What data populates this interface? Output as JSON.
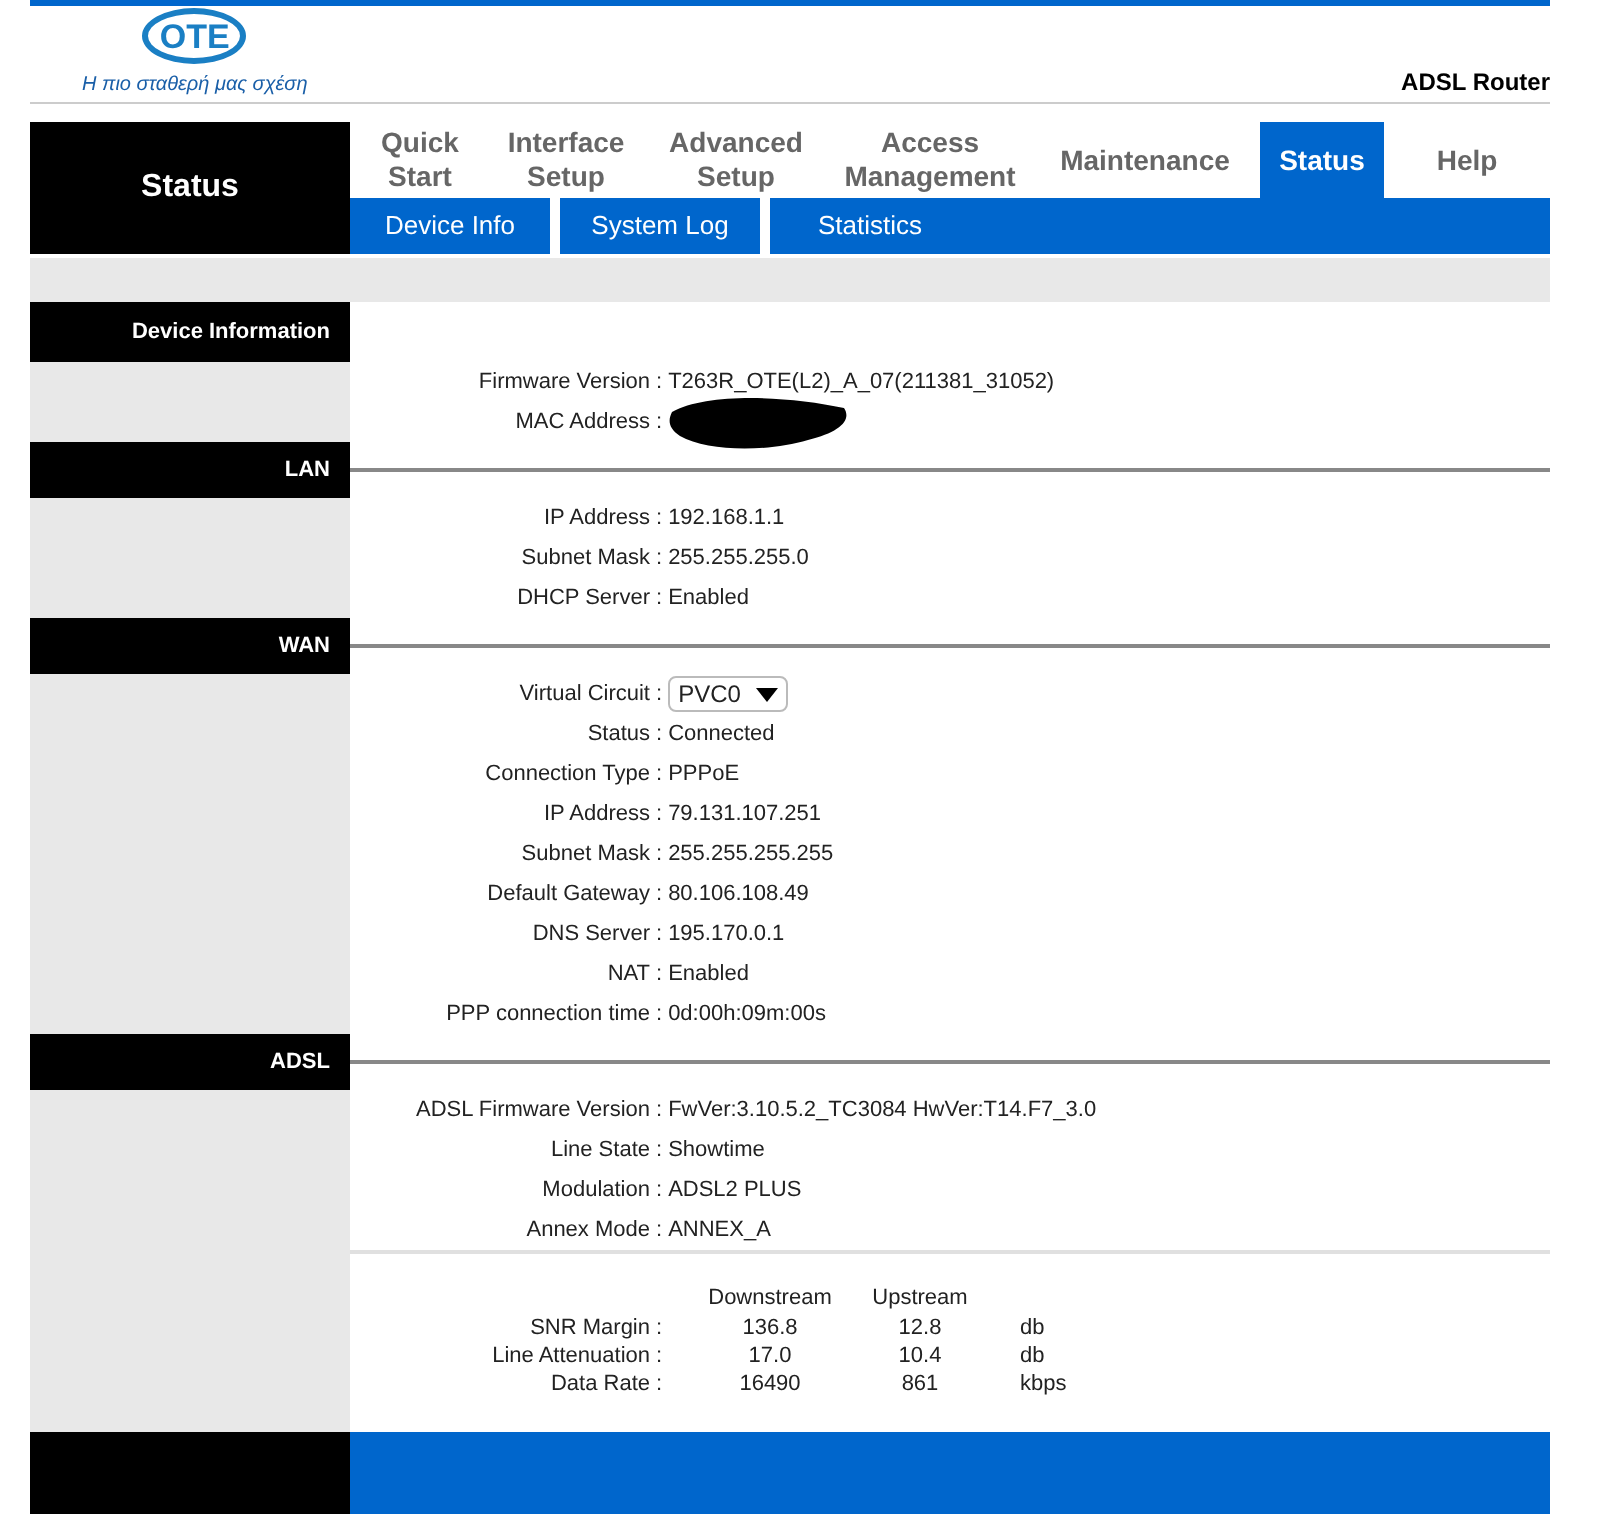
{
  "header": {
    "logo_text": "OTE",
    "tagline": "Η πιο σταθερή μας σχέση",
    "product": "ADSL Router"
  },
  "nav": {
    "section_title": "Status",
    "tabs": [
      {
        "label": "Quick Start",
        "selected": false
      },
      {
        "label": "Interface Setup",
        "selected": false
      },
      {
        "label": "Advanced Setup",
        "selected": false
      },
      {
        "label": "Access Management",
        "selected": false
      },
      {
        "label": "Maintenance",
        "selected": false
      },
      {
        "label": "Status",
        "selected": true
      },
      {
        "label": "Help",
        "selected": false
      }
    ],
    "subtabs": [
      {
        "label": "Device Info"
      },
      {
        "label": "System Log"
      },
      {
        "label": "Statistics"
      }
    ]
  },
  "sections": [
    {
      "title": "Device Information",
      "rows": [
        {
          "kind": "text",
          "label": "Firmware Version",
          "sep": ":",
          "value": "T263R_OTE(L2)_A_07(211381_31052)"
        },
        {
          "kind": "redacted",
          "label": "MAC Address",
          "sep": ":"
        }
      ]
    },
    {
      "title": "LAN",
      "rows": [
        {
          "kind": "text",
          "label": "IP Address",
          "sep": ":",
          "value": "192.168.1.1"
        },
        {
          "kind": "text",
          "label": "Subnet Mask",
          "sep": ":",
          "value": "255.255.255.0"
        },
        {
          "kind": "text",
          "label": "DHCP Server",
          "sep": ":",
          "value": "Enabled"
        }
      ]
    },
    {
      "title": "WAN",
      "rows": [
        {
          "kind": "select",
          "label": "Virtual Circuit",
          "sep": ":",
          "value": "PVC0"
        },
        {
          "kind": "text",
          "label": "Status",
          "sep": ":",
          "value": "Connected"
        },
        {
          "kind": "text",
          "label": "Connection Type",
          "sep": ":",
          "value": "PPPoE"
        },
        {
          "kind": "text",
          "label": "IP Address",
          "sep": ":",
          "value": "79.131.107.251"
        },
        {
          "kind": "text",
          "label": "Subnet Mask",
          "sep": ":",
          "value": "255.255.255.255"
        },
        {
          "kind": "text",
          "label": "Default Gateway",
          "sep": ":",
          "value": "80.106.108.49"
        },
        {
          "kind": "text",
          "label": "DNS Server",
          "sep": ":",
          "value": "195.170.0.1"
        },
        {
          "kind": "text",
          "label": "NAT",
          "sep": ":",
          "value": "Enabled"
        },
        {
          "kind": "text",
          "label": "PPP connection time",
          "sep": ":",
          "value": "0d:00h:09m:00s"
        }
      ]
    },
    {
      "title": "ADSL",
      "rows": [
        {
          "kind": "text",
          "label": "ADSL Firmware Version",
          "sep": ":",
          "value": "FwVer:3.10.5.2_TC3084 HwVer:T14.F7_3.0"
        },
        {
          "kind": "text",
          "label": "Line State",
          "sep": ":",
          "value": "Showtime"
        },
        {
          "kind": "text",
          "label": "Modulation",
          "sep": ":",
          "value": "ADSL2 PLUS"
        },
        {
          "kind": "text",
          "label": "Annex Mode",
          "sep": ":",
          "value": "ANNEX_A"
        }
      ],
      "stats": {
        "columns": [
          "Downstream",
          "Upstream"
        ],
        "rows": [
          {
            "label": "SNR Margin",
            "sep": ":",
            "down": "136.8",
            "up": "12.8",
            "unit": "db"
          },
          {
            "label": "Line Attenuation",
            "sep": ":",
            "down": "17.0",
            "up": "10.4",
            "unit": "db"
          },
          {
            "label": "Data Rate",
            "sep": ":",
            "down": "16490",
            "up": "861",
            "unit": "kbps"
          }
        ]
      }
    }
  ]
}
